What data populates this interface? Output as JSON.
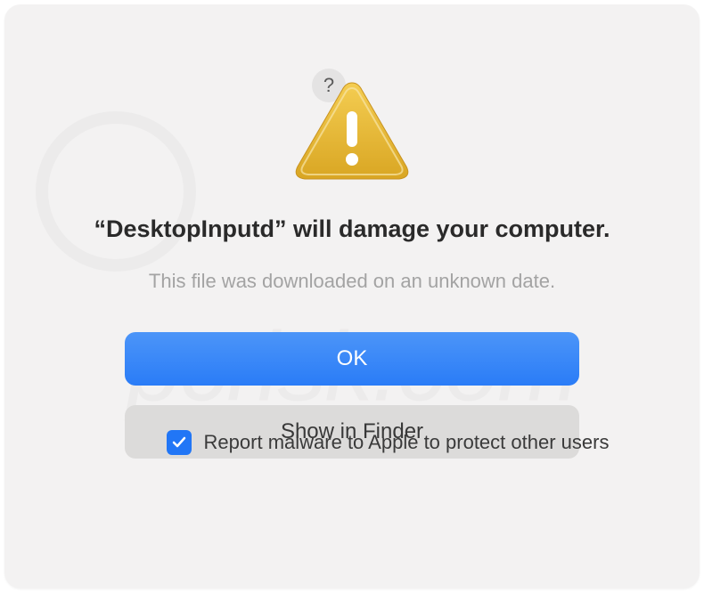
{
  "dialog": {
    "help_tooltip": "?",
    "title": "“DesktopInputd” will damage your computer.",
    "subtitle": "This file was downloaded on an unknown date.",
    "ok_label": "OK",
    "show_finder_label": "Show in Finder",
    "checkbox_label": "Report malware to Apple to protect other users",
    "checkbox_checked": true
  },
  "colors": {
    "primary": "#2a7cf7",
    "dialog_bg": "#f3f2f2",
    "secondary_btn": "#dcdbda",
    "subtitle_text": "#a3a3a3"
  }
}
